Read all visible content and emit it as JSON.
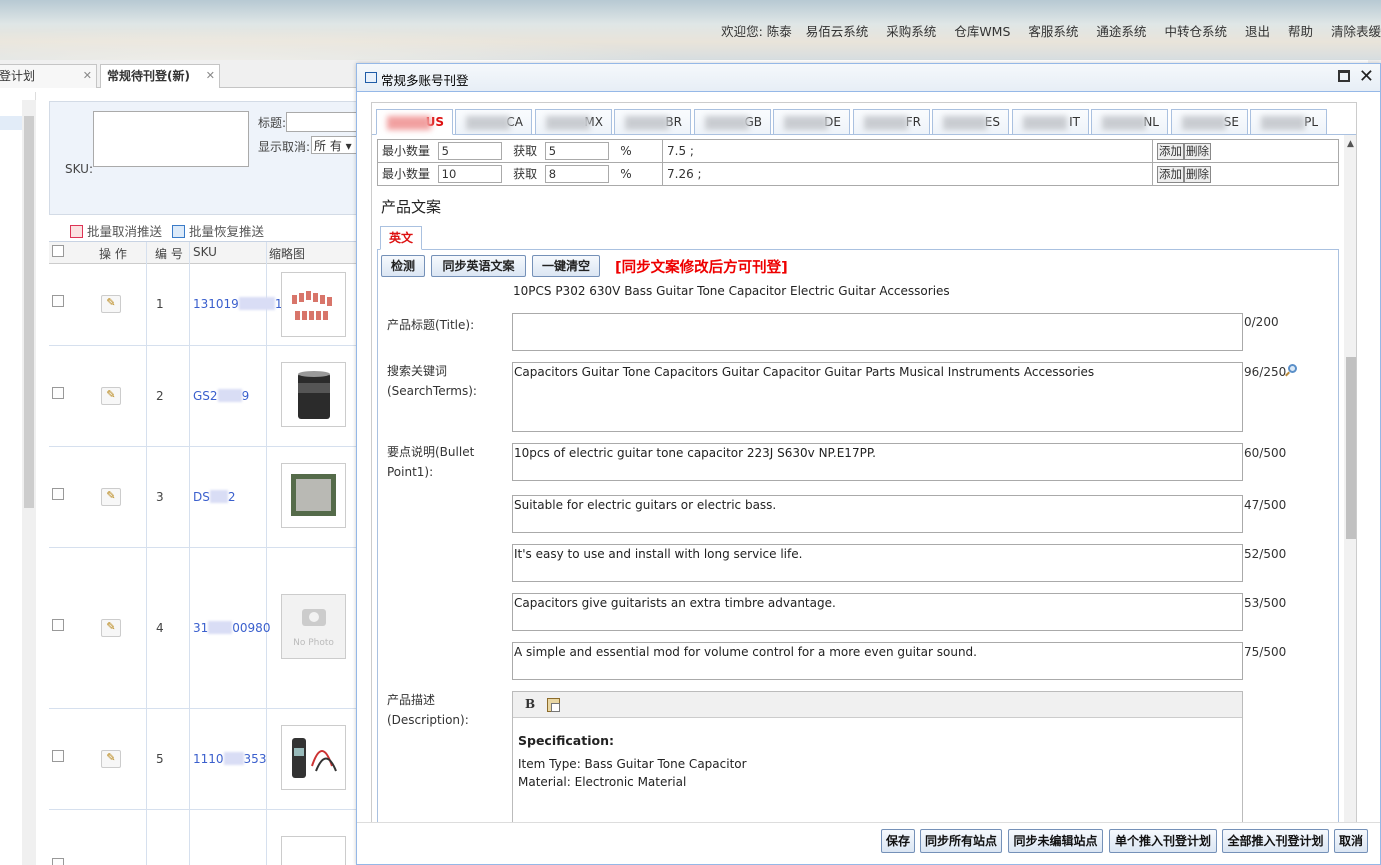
{
  "topnav": {
    "items": [
      "欢迎您: 陈泰",
      "易佰云系统",
      "采购系统",
      "仓库WMS",
      "客服系统",
      "通途系统",
      "中转仓系统",
      "退出",
      "帮助",
      "清除表缓"
    ]
  },
  "tabs": [
    {
      "label": "登计划",
      "close": "✕"
    },
    {
      "label": "常规待刊登(新)",
      "close": "✕"
    }
  ],
  "filter": {
    "sku_label": "SKU:",
    "title_label": "标题:",
    "show_cancel_label": "显示取消:",
    "show_cancel_value": "所 有 ▾"
  },
  "bulk": {
    "cancel_push": "批量取消推送",
    "restore_push": "批量恢复推送"
  },
  "grid": {
    "headers": {
      "op": "操 作",
      "no": "编 号",
      "sku": "SKU",
      "thumb": "缩略图"
    },
    "rows": [
      {
        "no": "1",
        "sku_a": "131019",
        "sku_b": "1"
      },
      {
        "no": "2",
        "sku_a": "GS2",
        "sku_b": "9"
      },
      {
        "no": "3",
        "sku_a": "DS",
        "sku_b": "2"
      },
      {
        "no": "4",
        "sku_a": "31",
        "sku_b": "00980"
      },
      {
        "no": "5",
        "sku_a": "1110",
        "sku_b": "353"
      }
    ],
    "no_photo": "No Photo"
  },
  "dialog": {
    "title": "常规多账号刊登",
    "site_tabs": [
      "US",
      "CA",
      "MX",
      "BR",
      "GB",
      "DE",
      "FR",
      "ES",
      "IT",
      "NL",
      "SE",
      "PL"
    ],
    "active_site": "US",
    "price_rules": [
      {
        "min_label": "最小数量",
        "min_value": "5",
        "take_label": "获取",
        "take_value": "5",
        "pct": "%",
        "result": "7.5 ;",
        "add": "添加",
        "del": "删除"
      },
      {
        "min_label": "最小数量",
        "min_value": "10",
        "take_label": "获取",
        "take_value": "8",
        "pct": "%",
        "result": "7.26 ;",
        "add": "添加",
        "del": "删除"
      }
    ],
    "section_title": "产品文案",
    "lang_tab": "英文",
    "actions": {
      "check": "检测",
      "sync_en": "同步英语文案",
      "clear": "一键清空"
    },
    "warning": "[同步文案修改后方可刊登]",
    "original_title": "10PCS P302 630V Bass Guitar Tone Capacitor Electric Guitar Accessories",
    "fields": {
      "title_label": "产品标题(Title):",
      "title_value": "",
      "title_count": "0/200",
      "search_label_1": "搜索关键词",
      "search_label_2": "(SearchTerms):",
      "search_value": "Capacitors Guitar Tone Capacitors Guitar  Capacitor Guitar Parts Musical Instruments Accessories",
      "search_count": "96/250",
      "bullet_label_1": "要点说明(Bullet",
      "bullet_label_2": "Point1):",
      "bullets": [
        {
          "text": "10pcs of electric guitar tone capacitor 223J S630v NP.E17PP.",
          "count": "60/500"
        },
        {
          "text": "Suitable for electric guitars or electric bass.",
          "count": "47/500"
        },
        {
          "text": "It's easy to use and install with long service life.",
          "count": "52/500"
        },
        {
          "text": "Capacitors give guitarists an extra timbre advantage.",
          "count": "53/500"
        },
        {
          "text": "A simple and essential mod for volume control for a more even guitar sound.",
          "count": "75/500"
        }
      ],
      "desc_label_1": "产品描述",
      "desc_label_2": "(Description):",
      "desc_bold_icon": "B",
      "desc_heading": "Specification:",
      "desc_line1": "Item Type: Bass Guitar Tone Capacitor",
      "desc_line2": "Material: Electronic Material"
    },
    "footer": {
      "save": "保存",
      "sync_all": "同步所有站点",
      "sync_unedited": "同步未编辑站点",
      "push_single": "单个推入刊登计划",
      "push_all": "全部推入刊登计划",
      "cancel": "取消"
    }
  }
}
